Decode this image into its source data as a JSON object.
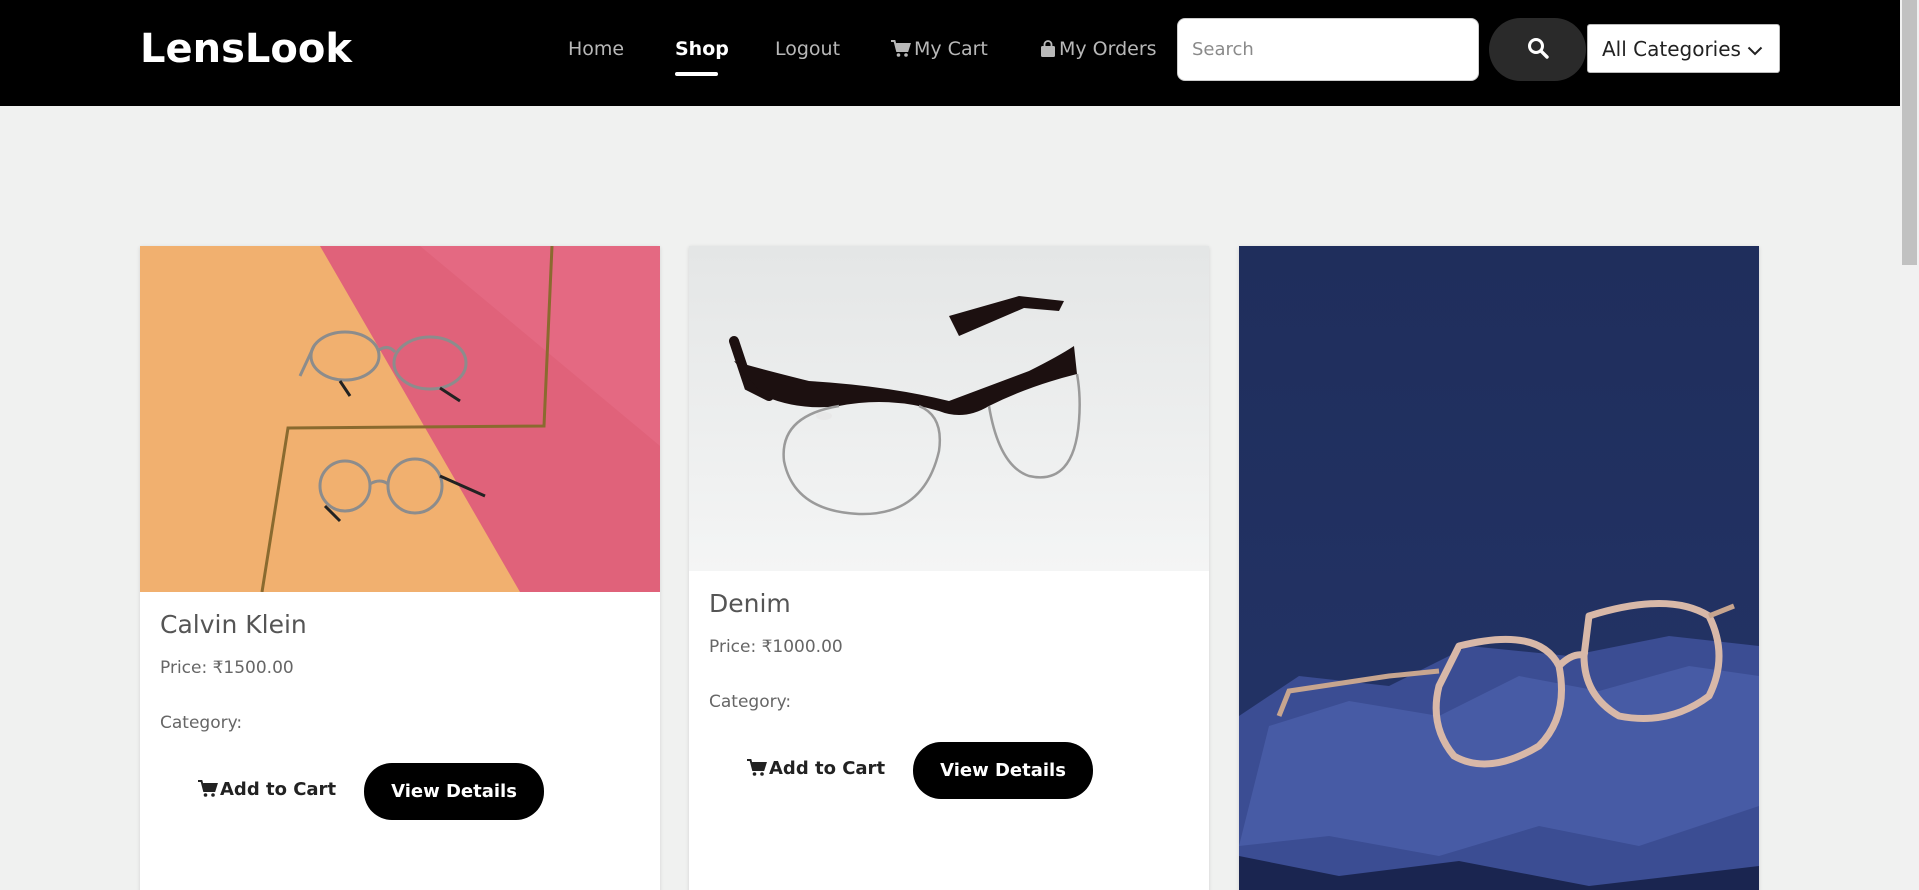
{
  "brand": "LensLook",
  "nav": {
    "home": "Home",
    "shop": "Shop",
    "logout": "Logout",
    "my_cart": "My Cart",
    "my_orders": "My Orders"
  },
  "search": {
    "placeholder": "Search",
    "value": ""
  },
  "category_select": {
    "selected": "All Categories"
  },
  "icons": {
    "cart": "cart-icon",
    "bag": "bag-icon",
    "search": "search-icon",
    "chevron": "chevron-down-icon"
  },
  "colors": {
    "navbar_bg": "#000000",
    "page_bg": "#f0f1f0",
    "button_bg": "#000000"
  },
  "products": [
    {
      "name": "Calvin Klein",
      "price": "Price: ₹1500.00",
      "category": "Category:",
      "add_to_cart": "Add to Cart",
      "view_details": "View Details"
    },
    {
      "name": "Denim",
      "price": "Price: ₹1000.00",
      "category": "Category:",
      "add_to_cart": "Add to Cart",
      "view_details": "View Details"
    },
    {
      "name": "",
      "price": "",
      "category": "",
      "add_to_cart": "",
      "view_details": ""
    }
  ]
}
